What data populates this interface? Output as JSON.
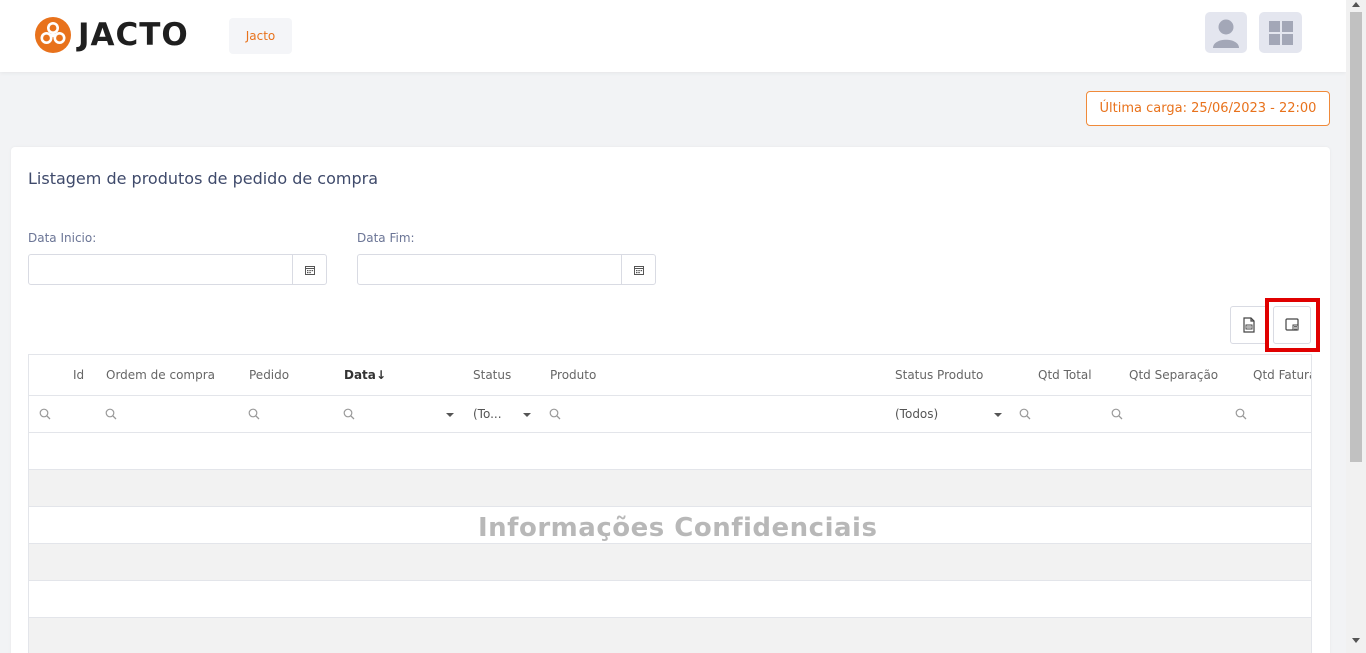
{
  "header": {
    "logo_text": "JACTO",
    "company_tag": "Jacto"
  },
  "status": {
    "last_load": "Última carga: 25/06/2023 - 22:00"
  },
  "card": {
    "title": "Listagem de produtos de pedido de compra"
  },
  "filters": {
    "start_label": "Data Inicio:",
    "end_label": "Data Fim:",
    "start_value": "",
    "end_value": ""
  },
  "grid": {
    "columns": [
      "Id",
      "Ordem de compra",
      "Pedido",
      "Data",
      "Status",
      "Produto",
      "Status Produto",
      "Qtd Total",
      "Qtd Separação",
      "Qtd Fatura"
    ],
    "sort_arrow": "↓",
    "status_filter": "(To...",
    "status_produto_filter": "(Todos)"
  },
  "watermark": "Informações Confidenciais",
  "colors": {
    "accent": "#e8721c",
    "highlight": "#e00000",
    "title": "#3f4a6b"
  },
  "icons": {
    "avatar": "user-icon",
    "apps": "grid-icon",
    "calendar": "calendar-icon",
    "export_pdf": "pdf-export-icon",
    "column_chooser": "column-chooser-icon",
    "search": "search-icon"
  }
}
